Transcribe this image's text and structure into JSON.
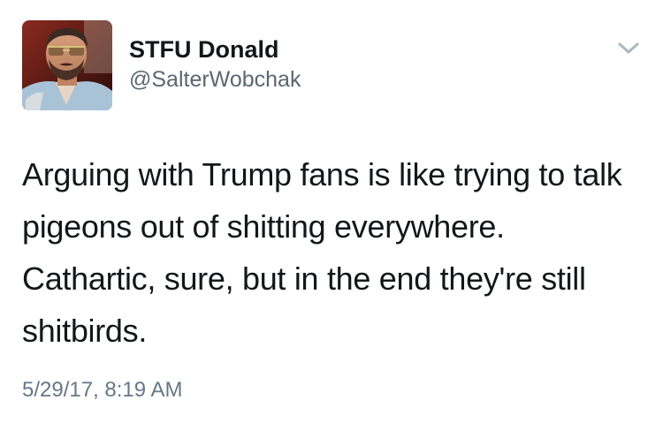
{
  "tweet": {
    "author": {
      "display_name": "STFU Donald",
      "handle": "@SalterWobchak",
      "avatar_icon": "profile-photo-man-in-sunglasses"
    },
    "menu_icon": "chevron-down-icon",
    "text": "Arguing with Trump fans is like trying to talk pigeons out of shitting everywhere. Cathartic, sure, but in the end they're still shitbirds.",
    "timestamp": "5/29/17, 8:19 AM"
  },
  "colors": {
    "text_primary": "#14171a",
    "text_secondary": "#657786",
    "icon_gray": "#aab8c2",
    "background": "#ffffff"
  }
}
